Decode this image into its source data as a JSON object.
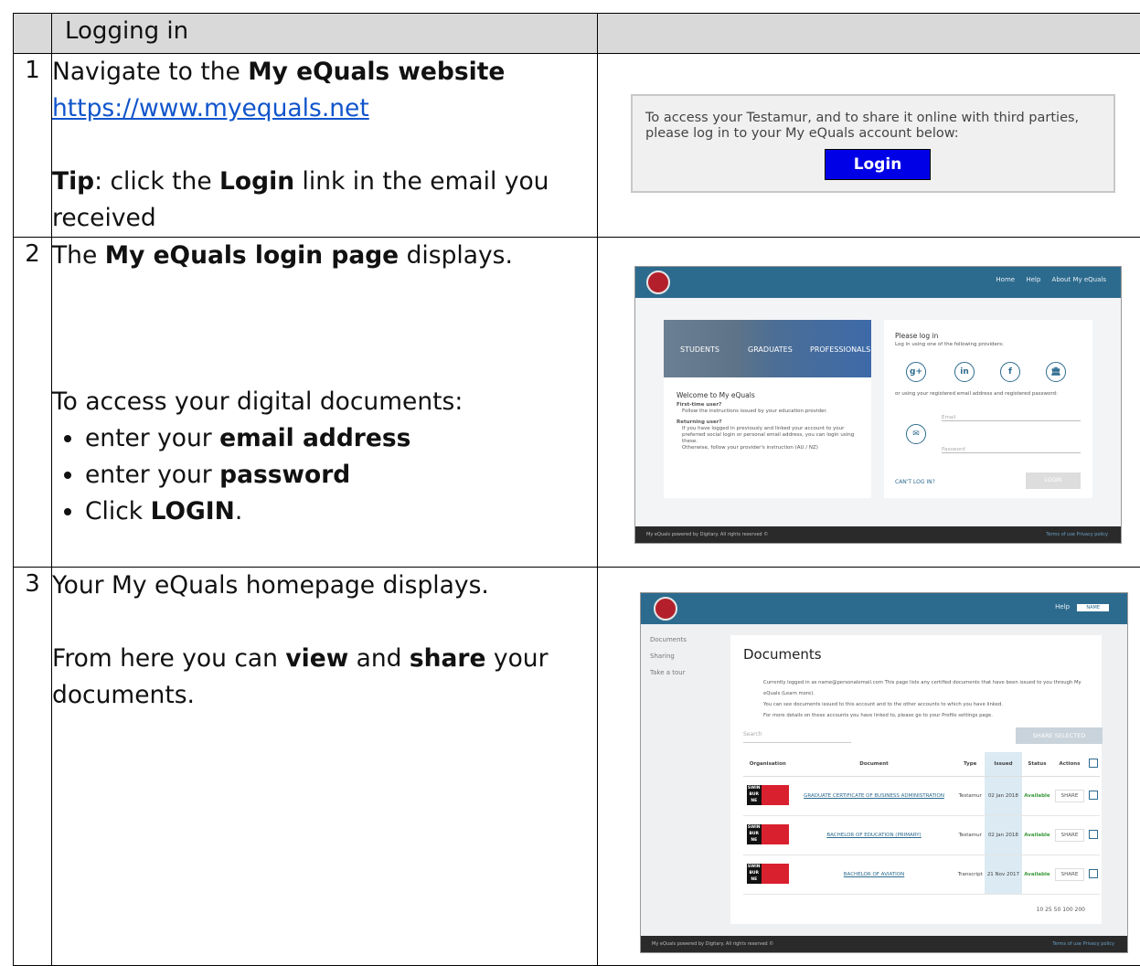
{
  "header": {
    "title": "Logging in",
    "image_col": ""
  },
  "steps": [
    {
      "num": "1",
      "line1_pre": "Navigate to the ",
      "line1_bold": "My eQuals website",
      "link": "https://www.myequals.net",
      "tip_label": "Tip",
      "tip_mid": ": click the ",
      "tip_bold": "Login",
      "tip_post": " link in the email you received"
    },
    {
      "num": "2",
      "line1_pre": "The ",
      "line1_bold": "My eQuals login page",
      "line1_post": " displays.",
      "intro": "To access your digital documents:",
      "bullets": [
        {
          "pre": "enter your ",
          "bold": "email address",
          "post": ""
        },
        {
          "pre": "enter your ",
          "bold": "password",
          "post": ""
        },
        {
          "pre": "Click ",
          "bold": "LOGIN",
          "post": "."
        }
      ]
    },
    {
      "num": "3",
      "line1": "Your My eQuals homepage displays.",
      "p2_pre": "From here you can ",
      "p2_b1": "view",
      "p2_mid": " and ",
      "p2_b2": "share",
      "p2_post": " your documents."
    }
  ],
  "shot1": {
    "message": "To access your Testamur, and to share it online with third parties, please log in to your My eQuals account below:",
    "button": "Login",
    "button_color": "#0000e6"
  },
  "shot2": {
    "nav": [
      "Home",
      "Help",
      "About My eQuals"
    ],
    "banner": [
      "STUDENTS",
      "GRADUATES",
      "PROFESSIONALS"
    ],
    "welcome": "Welcome to My eQuals",
    "first_time": "First-time user?",
    "first_time_text": "Follow the instructions issued by your education provider.",
    "returning": "Returning user?",
    "returning_text": "If you have logged in previously and linked your account to your preferred social login or personal email address, you can login using these.",
    "otherwise": "Otherwise, follow your provider's instruction (AU / NZ)",
    "please_log_in": "Please log in",
    "providers_text": "Log in using one of the following providers:",
    "providers": [
      "g+",
      "in",
      "f",
      "🏛"
    ],
    "or_text": "or using your registered email address and registered password:",
    "email_label": "Email",
    "password_label": "Password",
    "cant_login": "CAN'T LOG IN?",
    "login_button": "LOGIN",
    "footer": "My eQuals powered by Digitary. All rights reserved ©",
    "footer_right": "Terms of use     Privacy policy",
    "brand_color": "#2d6b8e"
  },
  "shot3": {
    "help": "Help",
    "name": "NAME",
    "side": [
      "Documents",
      "Sharing",
      "Take a tour"
    ],
    "title": "Documents",
    "info": [
      "Currently logged in as  name@personalemail.com  This page lists any certified documents that have been issued to you through My eQuals (Learn more).",
      "You can see documents issued to this account and to the other accounts to which you have linked.",
      "For more details on these accounts you have linked to, please go to your Profile settings page."
    ],
    "search": "Search",
    "share_selected": "SHARE SELECTED",
    "columns": [
      "Organisation",
      "Document",
      "Type",
      "Issued",
      "Status",
      "Actions",
      ""
    ],
    "rows": [
      {
        "org": "SWIN BUR NE",
        "doc": "GRADUATE CERTIFICATE OF BUSINESS ADMINISTRATION",
        "type": "Testamur",
        "issued": "02 Jan 2018",
        "status": "Available",
        "action": "SHARE"
      },
      {
        "org": "SWIN BUR NE",
        "doc": "BACHELOR OF EDUCATION (PRIMARY)",
        "type": "Testamur",
        "issued": "02 Jan 2018",
        "status": "Available",
        "action": "SHARE"
      },
      {
        "org": "SWIN BUR NE",
        "doc": "BACHELOR OF AVIATION",
        "type": "Transcript",
        "issued": "21 Nov 2017",
        "status": "Available",
        "action": "SHARE"
      }
    ],
    "pages": "10   25   50   100   200",
    "footer": "My eQuals powered by Digitary. All rights reserved ©",
    "footer_right": "Terms of use     Privacy policy"
  }
}
